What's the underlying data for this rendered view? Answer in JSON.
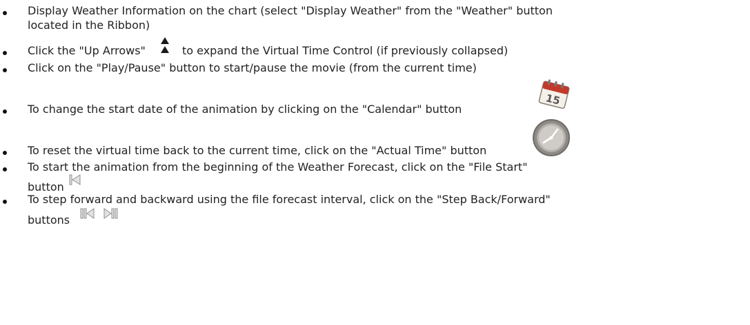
{
  "bullets": [
    {
      "line1": "Display Weather Information on the chart (select \"Display Weather\" from the \"Weather\" button",
      "line2": "located in the Ribbon)"
    },
    {
      "before_icon": "Click the \"Up Arrows\"",
      "after_icon": "to expand the Virtual Time Control (if previously collapsed)",
      "icon": "double-up-arrow-icon"
    },
    {
      "text": "Click on the \"Play/Pause\" button to start/pause the movie (from the current time)"
    },
    {
      "text": "To change the start date of the animation by clicking on the \"Calendar\" button",
      "icon": "calendar-icon",
      "calendar_day": "15"
    },
    {
      "text": "To reset the virtual time back to the current time, click on the \"Actual Time\" button",
      "icon": "clock-icon"
    },
    {
      "line1": "To start the animation from the beginning of the Weather Forecast, click on the \"File Start\"",
      "line2": "button",
      "icon": "file-start-icon"
    },
    {
      "line1": "To step forward and backward using the file forecast interval, click on the \"Step Back/Forward\"",
      "line2": "buttons",
      "icons": [
        "step-back-icon",
        "step-forward-icon"
      ]
    }
  ]
}
